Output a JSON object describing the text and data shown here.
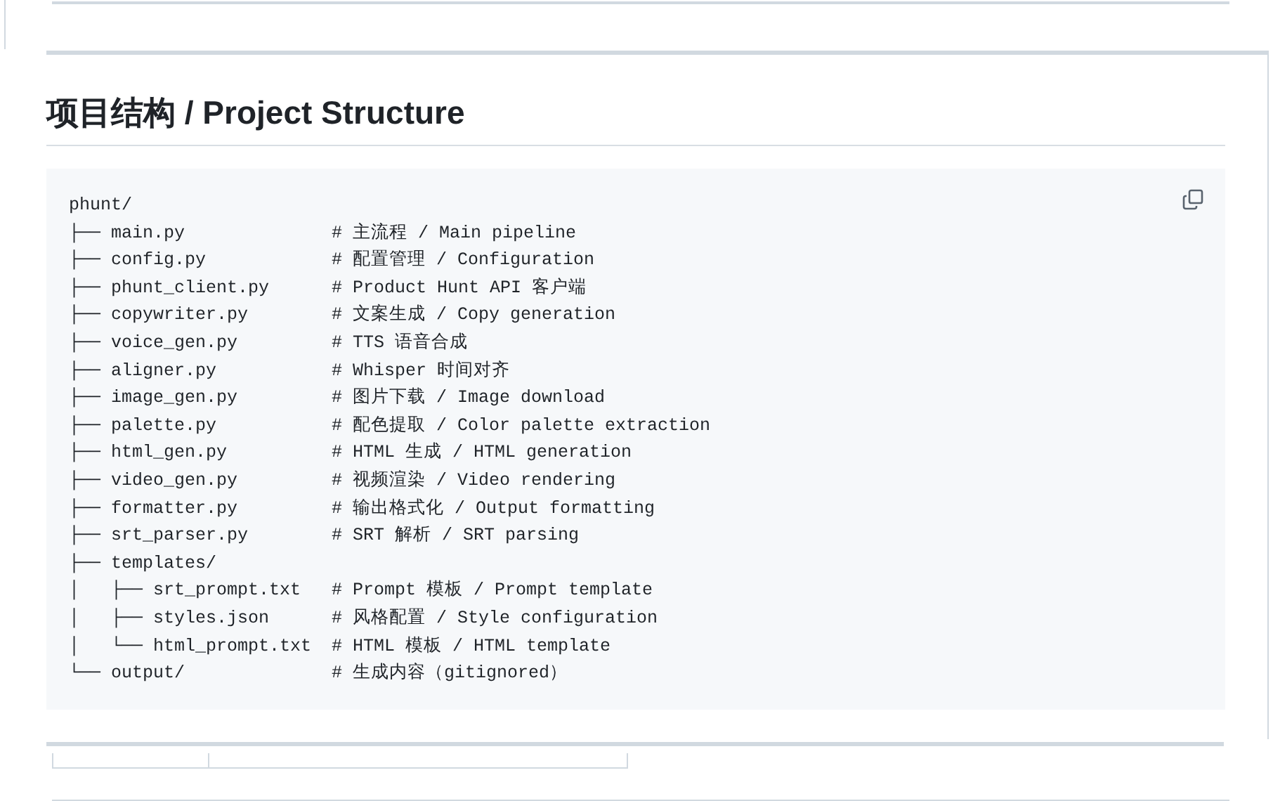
{
  "section": {
    "heading": "项目结构 / Project Structure",
    "code_block": {
      "root": "phunt/",
      "entries": [
        {
          "prefix": "├── ",
          "name": "main.py",
          "comment": "# 主流程 / Main pipeline"
        },
        {
          "prefix": "├── ",
          "name": "config.py",
          "comment": "# 配置管理 / Configuration"
        },
        {
          "prefix": "├── ",
          "name": "phunt_client.py",
          "comment": "# Product Hunt API 客户端"
        },
        {
          "prefix": "├── ",
          "name": "copywriter.py",
          "comment": "# 文案生成 / Copy generation"
        },
        {
          "prefix": "├── ",
          "name": "voice_gen.py",
          "comment": "# TTS 语音合成"
        },
        {
          "prefix": "├── ",
          "name": "aligner.py",
          "comment": "# Whisper 时间对齐"
        },
        {
          "prefix": "├── ",
          "name": "image_gen.py",
          "comment": "# 图片下载 / Image download"
        },
        {
          "prefix": "├── ",
          "name": "palette.py",
          "comment": "# 配色提取 / Color palette extraction"
        },
        {
          "prefix": "├── ",
          "name": "html_gen.py",
          "comment": "# HTML 生成 / HTML generation"
        },
        {
          "prefix": "├── ",
          "name": "video_gen.py",
          "comment": "# 视频渲染 / Video rendering"
        },
        {
          "prefix": "├── ",
          "name": "formatter.py",
          "comment": "# 输出格式化 / Output formatting"
        },
        {
          "prefix": "├── ",
          "name": "srt_parser.py",
          "comment": "# SRT 解析 / SRT parsing"
        },
        {
          "prefix": "├── ",
          "name": "templates/",
          "children": [
            {
              "prefix": "│   ├── ",
              "name": "srt_prompt.txt",
              "comment": "# Prompt 模板 / Prompt template"
            },
            {
              "prefix": "│   ├── ",
              "name": "styles.json",
              "comment": "# 风格配置 / Style configuration"
            },
            {
              "prefix": "│   └── ",
              "name": "html_prompt.txt",
              "comment": "# HTML 模板 / HTML template"
            }
          ]
        },
        {
          "prefix": "└── ",
          "name": "output/",
          "comment": "# 生成内容（gitignored）"
        }
      ]
    }
  }
}
